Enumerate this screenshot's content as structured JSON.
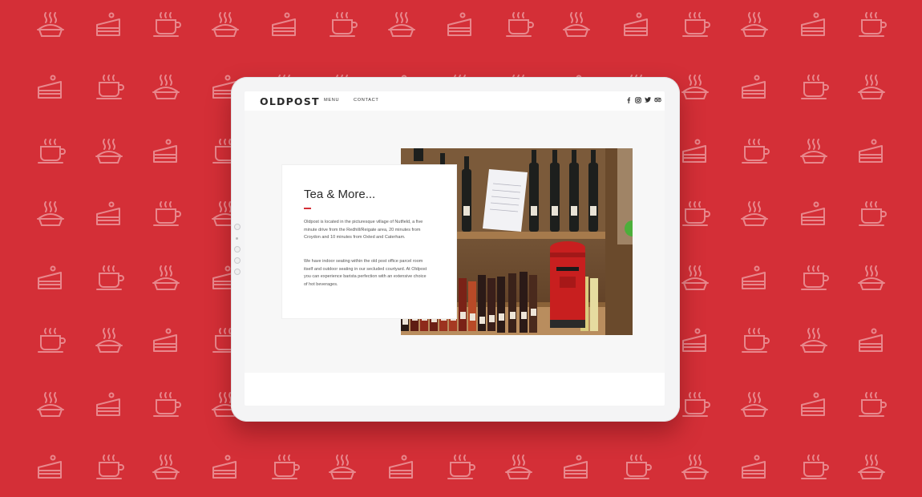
{
  "background": {
    "color": "#d42f37",
    "pattern_color": "#e8878c",
    "pattern_icons": [
      "pie-icon",
      "cake-slice-icon",
      "coffee-cup-icon"
    ]
  },
  "site": {
    "logo": "OLDPOST",
    "nav": {
      "menu": "MENU",
      "contact": "CONTACT"
    },
    "social_icons": [
      "facebook-icon",
      "instagram-icon",
      "twitter-icon",
      "tripadvisor-icon"
    ]
  },
  "card": {
    "title": "Tea & More...",
    "para1": "Oldpost is located in the picturesque village of Nutfield, a five minute drive from the Redhill/Reigate area, 20 minutes from Croydon and 10 minutes from Oxted and Caterham.",
    "para2": "We have indoor seating within the old post office parcel room itself and outdoor seating in our secluded courtyard. At Oldpost you can experience barista perfection with an extensive choice of hot beverages.",
    "accent": "#d42f37"
  }
}
